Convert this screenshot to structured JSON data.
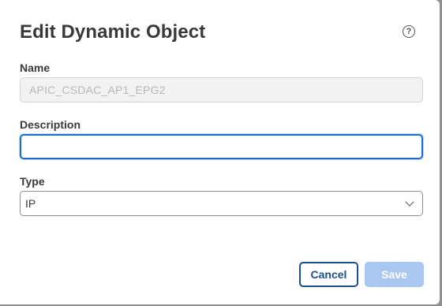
{
  "dialog": {
    "title": "Edit Dynamic Object",
    "help_icon_glyph": "?"
  },
  "form": {
    "name": {
      "label": "Name",
      "value": "APIC_CSDAC_AP1_EPG2"
    },
    "description": {
      "label": "Description",
      "value": ""
    },
    "type": {
      "label": "Type",
      "selected": "IP"
    }
  },
  "actions": {
    "cancel_label": "Cancel",
    "save_label": "Save"
  },
  "colors": {
    "accent": "#1d4f91",
    "focus": "#1f6cd1",
    "save_disabled": "#a9c7f0"
  }
}
